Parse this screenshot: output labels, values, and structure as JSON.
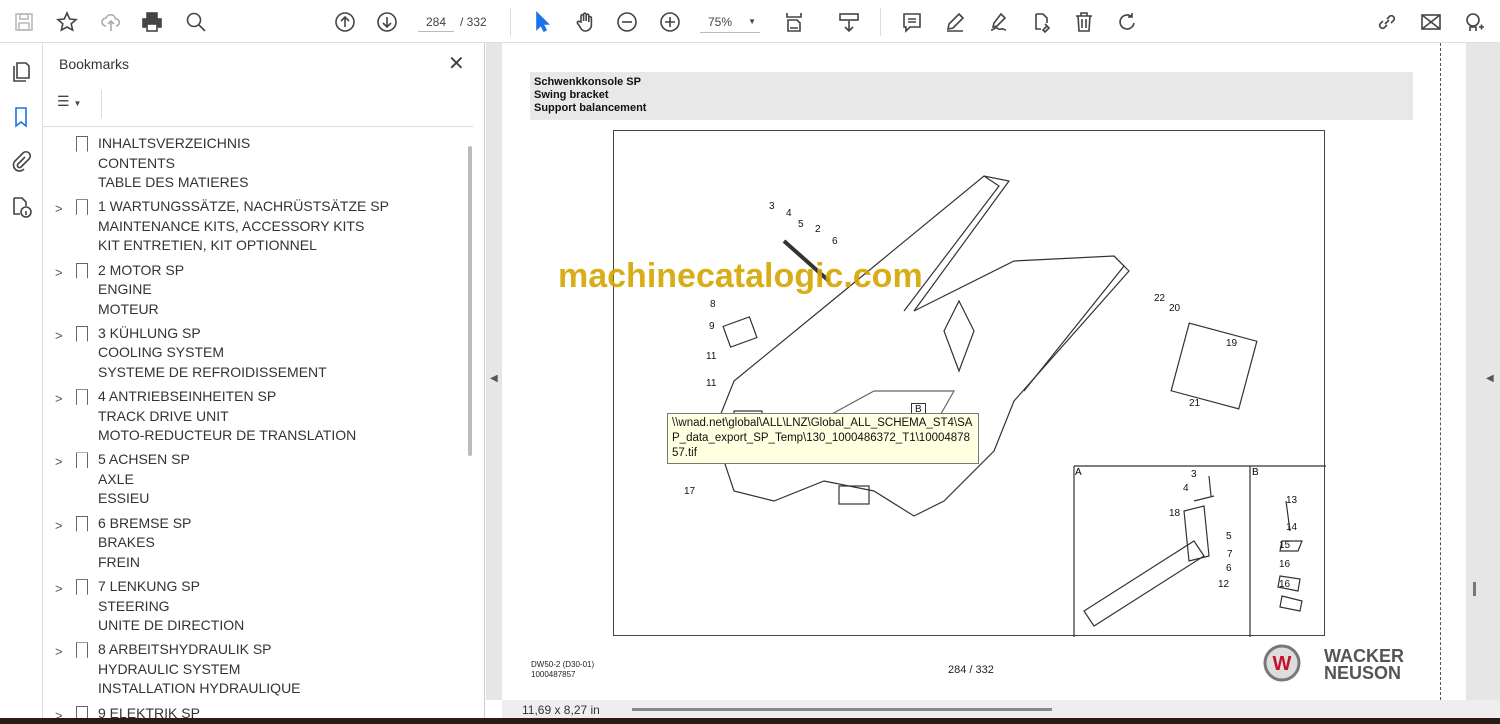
{
  "toolbar": {
    "page_current": "284",
    "page_total": "/ 332",
    "zoom": "75%",
    "icons": [
      "save-icon",
      "star-icon",
      "cloud-upload-icon",
      "print-icon",
      "search-zoom-icon",
      "page-up-icon",
      "page-down-icon",
      "select-cursor-icon",
      "hand-icon",
      "zoom-out-icon",
      "zoom-in-icon",
      "fit-page-icon",
      "scroll-mode-icon",
      "comment-icon",
      "highlight-icon",
      "sign-icon",
      "edit-pdf-icon",
      "delete-icon",
      "rotate-icon",
      "link-icon",
      "email-icon",
      "add-user-icon"
    ]
  },
  "bookmarks": {
    "title": "Bookmarks",
    "items": [
      {
        "lines": [
          "INHALTSVERZEICHNIS",
          "CONTENTS",
          "TABLE DES MATIERES"
        ],
        "expandable": false
      },
      {
        "lines": [
          "1 WARTUNGSSÄTZE, NACHRÜSTSÄTZE SP",
          "MAINTENANCE KITS, ACCESSORY KITS",
          "KIT ENTRETIEN, KIT OPTIONNEL"
        ],
        "expandable": true
      },
      {
        "lines": [
          "2 MOTOR SP",
          "ENGINE",
          "MOTEUR"
        ],
        "expandable": true
      },
      {
        "lines": [
          "3 KÜHLUNG SP",
          "COOLING SYSTEM",
          "SYSTEME DE REFROIDISSEMENT"
        ],
        "expandable": true
      },
      {
        "lines": [
          "4 ANTRIEBSEINHEITEN SP",
          "TRACK DRIVE UNIT",
          "MOTO-REDUCTEUR DE TRANSLATION"
        ],
        "expandable": true
      },
      {
        "lines": [
          "5 ACHSEN SP",
          "AXLE",
          "ESSIEU"
        ],
        "expandable": true
      },
      {
        "lines": [
          "6 BREMSE SP",
          "BRAKES",
          "FREIN"
        ],
        "expandable": true
      },
      {
        "lines": [
          "7 LENKUNG SP",
          "STEERING",
          "UNITE DE DIRECTION"
        ],
        "expandable": true
      },
      {
        "lines": [
          "8 ARBEITSHYDRAULIK SP",
          "HYDRAULIC SYSTEM",
          "INSTALLATION HYDRAULIQUE"
        ],
        "expandable": true
      },
      {
        "lines": [
          "9 ELEKTRIK SP"
        ],
        "expandable": true
      }
    ]
  },
  "page": {
    "header": [
      "Schwenkkonsole SP",
      "Swing bracket",
      "Support balancement"
    ],
    "watermark": "machinecatalogic.com",
    "tooltip": "\\\\wnad.net\\global\\ALL\\LNZ\\Global_ALL_SCHEMA_ST4\\SAP_data_export_SP_Temp\\130_1000486372_T1\\1000487857.tif",
    "footer_model": "DW50-2 (D30-01)",
    "footer_number": "1000487857",
    "footer_page": "284 / 332",
    "logo_text": [
      "WACKER",
      "NEUSON"
    ],
    "inset_labels": [
      "A",
      "B"
    ],
    "callouts_main": [
      "3",
      "4",
      "5",
      "2",
      "6",
      "8",
      "9",
      "11",
      "11",
      "17",
      "22",
      "20",
      "19",
      "21",
      "A",
      "B"
    ],
    "callouts_a": [
      "3",
      "4",
      "18",
      "5",
      "7",
      "6",
      "12"
    ],
    "callouts_b": [
      "13",
      "14",
      "15",
      "16",
      "16"
    ]
  },
  "status": {
    "page_size": "11,69 x 8,27 in"
  }
}
